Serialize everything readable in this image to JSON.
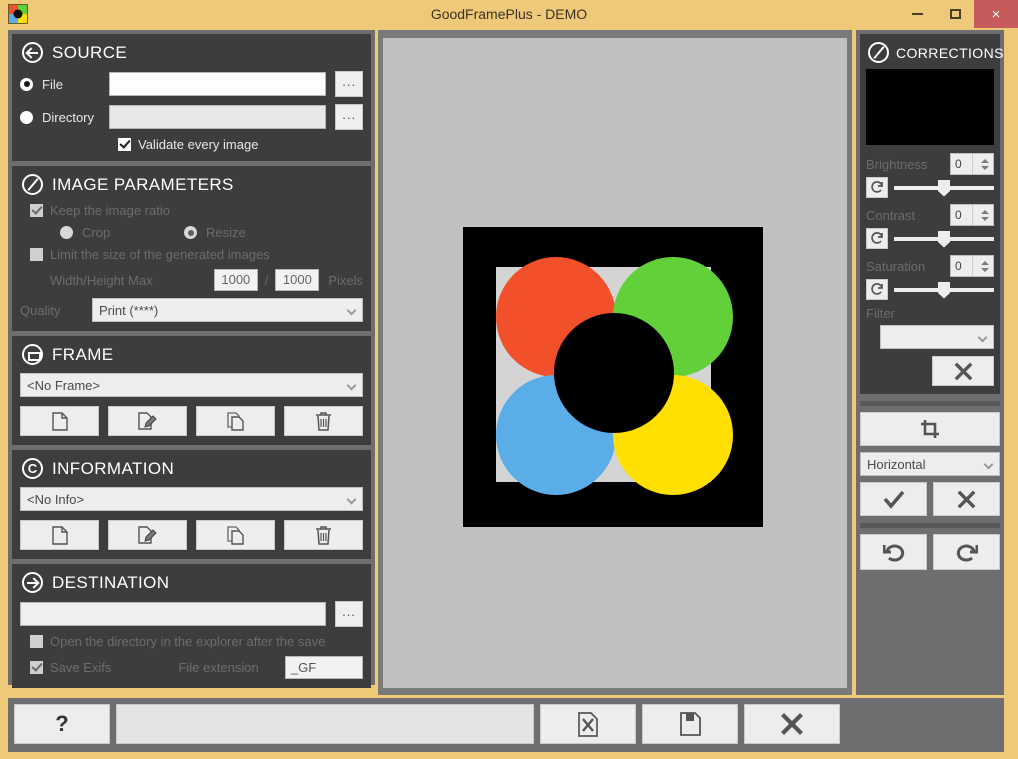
{
  "window": {
    "title": "GoodFramePlus - DEMO",
    "app_icon": "goodframeplus-logo-icon",
    "minimize_label": "",
    "maximize_label": "",
    "close_label": "×",
    "titlebar_color": "#EFC97A",
    "close_color": "#C75B5B"
  },
  "source": {
    "title": "SOURCE",
    "icon": "arrow-left-circle-icon",
    "file_label": "File",
    "file_value": "",
    "file_selected": true,
    "file_browse_label": "...",
    "directory_label": "Directory",
    "directory_value": "",
    "directory_selected": false,
    "directory_browse_label": "...",
    "validate_label": "Validate every image",
    "validate_checked": true
  },
  "image_parameters": {
    "title": "IMAGE PARAMETERS",
    "icon": "slash-circle-icon",
    "keep_ratio_label": "Keep the image ratio",
    "keep_ratio_checked": true,
    "crop_label": "Crop",
    "crop_selected": false,
    "resize_label": "Resize",
    "resize_selected": true,
    "limit_size_label": "Limit the size of the generated images",
    "limit_size_checked": false,
    "wh_max_label": "Width/Height Max",
    "width_value": "1000",
    "separator": "/",
    "height_value": "1000",
    "pixels_label": "Pixels",
    "quality_label": "Quality",
    "quality_value": "Print (****)"
  },
  "frame": {
    "title": "FRAME",
    "icon": "rectangle-circle-icon",
    "selected": "<No Frame>",
    "buttons": [
      {
        "name": "new-frame-button",
        "icon": "document-icon"
      },
      {
        "name": "edit-frame-button",
        "icon": "edit-document-icon"
      },
      {
        "name": "copy-frame-button",
        "icon": "copy-icon"
      },
      {
        "name": "delete-frame-button",
        "icon": "trash-icon"
      }
    ]
  },
  "information": {
    "title": "INFORMATION",
    "icon": "copyright-circle-icon",
    "selected": "<No Info>",
    "buttons": [
      {
        "name": "new-info-button",
        "icon": "document-icon"
      },
      {
        "name": "edit-info-button",
        "icon": "edit-document-icon"
      },
      {
        "name": "copy-info-button",
        "icon": "copy-icon"
      },
      {
        "name": "delete-info-button",
        "icon": "trash-icon"
      }
    ]
  },
  "destination": {
    "title": "DESTINATION",
    "icon": "arrow-right-circle-icon",
    "path_value": "",
    "browse_label": "...",
    "open_explorer_label": "Open the directory in the explorer after the save",
    "open_explorer_checked": false,
    "save_exifs_label": "Save Exifs",
    "save_exifs_checked": true,
    "file_extension_label": "File extension",
    "file_extension_value": "_GF"
  },
  "corrections": {
    "title": "CORRECTIONS",
    "icon": "slash-circle-icon",
    "thumbnail_color": "#000000",
    "sliders": [
      {
        "label": "Brightness",
        "value": "0",
        "reset_icon": "refresh-icon",
        "position": 50
      },
      {
        "label": "Contrast",
        "value": "0",
        "reset_icon": "refresh-icon",
        "position": 50
      },
      {
        "label": "Saturation",
        "value": "0",
        "reset_icon": "refresh-icon",
        "position": 50
      }
    ],
    "filter_label": "Filter",
    "filter_value": "",
    "clear_filter_icon": "close-x-icon",
    "crop_button_icon": "crop-icon",
    "orientation_value": "Horizontal",
    "apply_icon": "checkmark-icon",
    "cancel_icon": "close-x-icon",
    "undo_icon": "undo-arrow-icon",
    "redo_icon": "redo-arrow-icon"
  },
  "preview": {
    "name": "image-preview",
    "background_color": "#000000",
    "inner_color": "#d4d4d4",
    "circles": [
      {
        "name": "red-circle",
        "color": "#F2502B"
      },
      {
        "name": "green-circle",
        "color": "#62D139"
      },
      {
        "name": "blue-circle",
        "color": "#5BADE8"
      },
      {
        "name": "yellow-circle",
        "color": "#FFE000"
      },
      {
        "name": "center-circle",
        "color": "#000000"
      }
    ]
  },
  "bottom_bar": {
    "help_label": "?",
    "progress_value": "",
    "process_icon": "document-tools-icon",
    "save_icon": "floppy-save-icon",
    "close_icon": "close-x-icon"
  }
}
